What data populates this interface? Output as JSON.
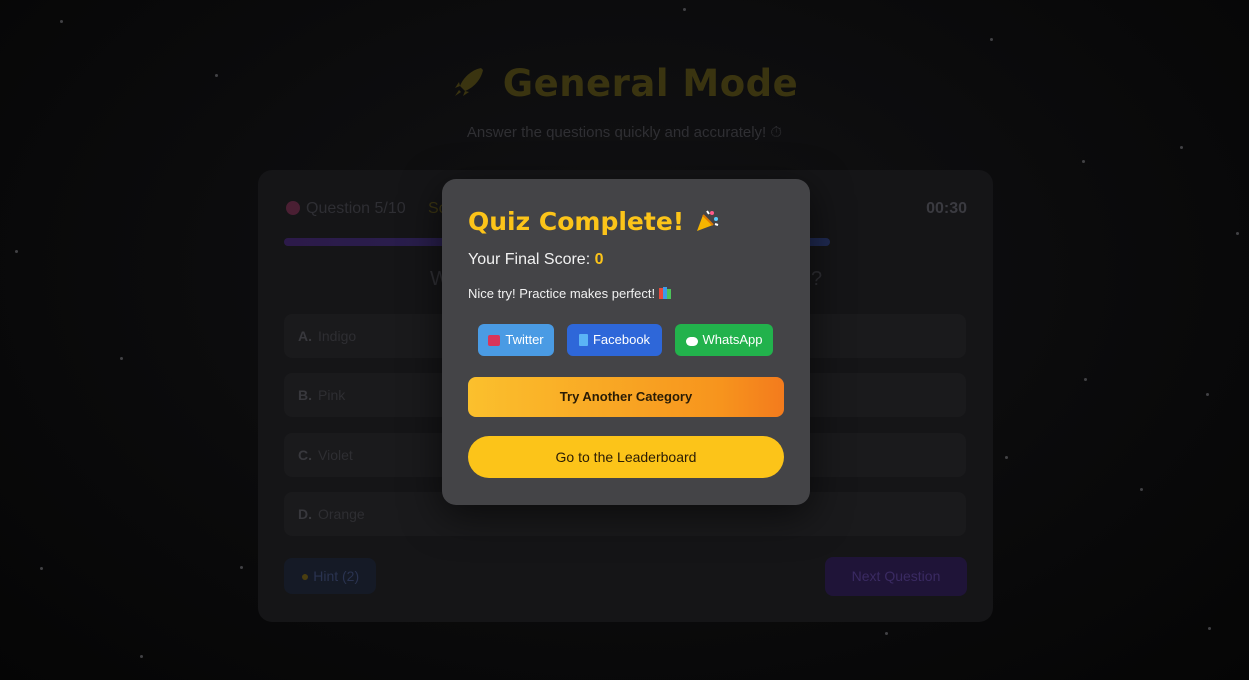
{
  "page": {
    "title": "General Mode",
    "subtitle": "Answer the questions quickly and accurately! ⏱"
  },
  "quiz": {
    "question_counter": "Question 5/10",
    "score_label": "Sc",
    "timer": "00:30",
    "question_fragment_left": "W",
    "question_fragment_right": "?",
    "options": [
      {
        "letter": "A.",
        "text": "Indigo"
      },
      {
        "letter": "B.",
        "text": "Pink"
      },
      {
        "letter": "C.",
        "text": "Violet"
      },
      {
        "letter": "D.",
        "text": "Orange"
      }
    ],
    "hint_label": "Hint (2)",
    "next_label": "Next Question"
  },
  "modal": {
    "title": "Quiz Complete!",
    "final_score_label": "Your Final Score:",
    "final_score_value": "0",
    "message": "Nice try! Practice makes perfect!",
    "share": {
      "twitter": "Twitter",
      "facebook": "Facebook",
      "whatsapp": "WhatsApp"
    },
    "try_another": "Try Another Category",
    "leaderboard": "Go to the Leaderboard"
  },
  "colors": {
    "accent": "#fcc419",
    "modal_bg": "#444447",
    "twitter": "#4a9be4",
    "facebook": "#2e67d9",
    "whatsapp": "#22b24c"
  },
  "icons": {
    "title": "rocket-icon",
    "timer": "stopwatch-icon",
    "question": "brain-icon",
    "modal_title": "party-popper-icon",
    "message": "books-icon",
    "hint": "lightbulb-icon"
  }
}
